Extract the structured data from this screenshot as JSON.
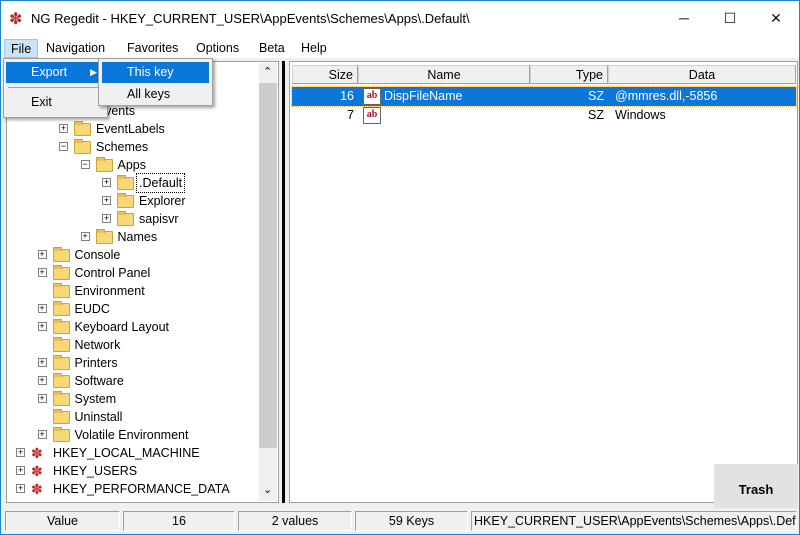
{
  "window": {
    "title": "NG Regedit - HKEY_CURRENT_USER\\AppEvents\\Schemes\\Apps\\.Default\\",
    "minimize": "─",
    "maximize": "☐",
    "close": "✕"
  },
  "menubar": [
    "File",
    "Navigation",
    "Favorites",
    "Options",
    "Beta",
    "Help"
  ],
  "file_menu": {
    "export": "Export",
    "exit": "Exit",
    "submenu": [
      "This key",
      "All keys"
    ]
  },
  "tree": [
    {
      "label": "AppEvents",
      "level": 1,
      "exp": "minus",
      "icon": "folder"
    },
    {
      "label": "EventLabels",
      "level": 2,
      "exp": "plus",
      "icon": "folder"
    },
    {
      "label": "Schemes",
      "level": 2,
      "exp": "minus",
      "icon": "folder"
    },
    {
      "label": "Apps",
      "level": 3,
      "exp": "minus",
      "icon": "folder"
    },
    {
      "label": ".Default",
      "level": 4,
      "exp": "plus",
      "icon": "folder",
      "selected": true
    },
    {
      "label": "Explorer",
      "level": 4,
      "exp": "plus",
      "icon": "folder"
    },
    {
      "label": "sapisvr",
      "level": 4,
      "exp": "plus",
      "icon": "folder"
    },
    {
      "label": "Names",
      "level": 3,
      "exp": "plus",
      "icon": "folder"
    },
    {
      "label": "Console",
      "level": 1,
      "exp": "plus",
      "icon": "folder"
    },
    {
      "label": "Control Panel",
      "level": 1,
      "exp": "plus",
      "icon": "folder"
    },
    {
      "label": "Environment",
      "level": 1,
      "exp": "none",
      "icon": "folder"
    },
    {
      "label": "EUDC",
      "level": 1,
      "exp": "plus",
      "icon": "folder"
    },
    {
      "label": "Keyboard Layout",
      "level": 1,
      "exp": "plus",
      "icon": "folder"
    },
    {
      "label": "Network",
      "level": 1,
      "exp": "none",
      "icon": "folder"
    },
    {
      "label": "Printers",
      "level": 1,
      "exp": "plus",
      "icon": "folder"
    },
    {
      "label": "Software",
      "level": 1,
      "exp": "plus",
      "icon": "folder"
    },
    {
      "label": "System",
      "level": 1,
      "exp": "plus",
      "icon": "folder"
    },
    {
      "label": "Uninstall",
      "level": 1,
      "exp": "none",
      "icon": "folder"
    },
    {
      "label": "Volatile Environment",
      "level": 1,
      "exp": "plus",
      "icon": "folder"
    },
    {
      "label": "HKEY_LOCAL_MACHINE",
      "level": 0,
      "exp": "plus",
      "icon": "hive"
    },
    {
      "label": "HKEY_USERS",
      "level": 0,
      "exp": "plus",
      "icon": "hive"
    },
    {
      "label": "HKEY_PERFORMANCE_DATA",
      "level": 0,
      "exp": "plus",
      "icon": "hive"
    }
  ],
  "values": {
    "columns": [
      "Size",
      "Name",
      "Type",
      "Data"
    ],
    "rows": [
      {
        "size": "16",
        "name": "DispFileName",
        "type": "SZ",
        "data": "@mmres.dll,-5856",
        "selected": true
      },
      {
        "size": "7",
        "name": "",
        "type": "SZ",
        "data": "Windows"
      }
    ]
  },
  "trash": "Trash",
  "status": [
    "Value",
    "16",
    "2 values",
    "59 Keys",
    "HKEY_CURRENT_USER\\AppEvents\\Schemes\\Apps\\.Default\\"
  ],
  "colors": {
    "accent": "#0b77d8",
    "menu_open": "#cce4f7"
  }
}
